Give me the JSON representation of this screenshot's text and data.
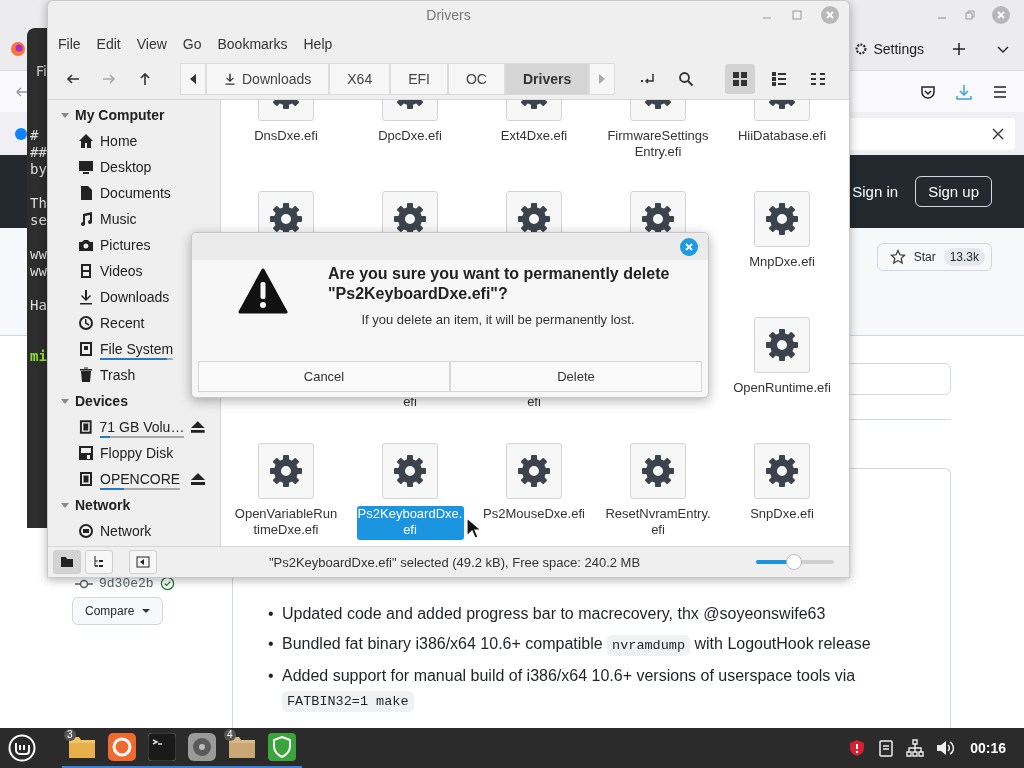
{
  "browser": {
    "tab": {
      "label": "Settings"
    },
    "header": {
      "sign_in": "Sign in",
      "sign_up": "Sign up"
    },
    "star_button": {
      "label": "Star",
      "count": "13.3k"
    },
    "commit": {
      "hash": "9d30e2b"
    },
    "compare_button": "Compare",
    "release_notes": [
      {
        "marker": "•",
        "segments": [
          {
            "kind": "text",
            "text": "Updated code and added progress bar to macrecovery, thx @soyeonswife63"
          }
        ]
      },
      {
        "marker": "•",
        "segments": [
          {
            "kind": "text",
            "text": "Bundled fat binary i386/x64 10.6+ compatible "
          },
          {
            "kind": "code",
            "text": "nvramdump"
          },
          {
            "kind": "text",
            "text": " with LogoutHook release"
          }
        ]
      },
      {
        "marker": "•",
        "segments": [
          {
            "kind": "text",
            "text": "Added support for manual build of i386/x64 10.6+ versions of userspace tools via "
          },
          {
            "kind": "code",
            "text": "FATBIN32=1 make"
          }
        ]
      }
    ]
  },
  "terminal": {
    "title": "Fi",
    "lines": [
      {
        "kind": "plain",
        "text": "#"
      },
      {
        "kind": "plain",
        "text": "##"
      },
      {
        "kind": "plain",
        "text": "by"
      },
      {
        "kind": "blank"
      },
      {
        "kind": "plain",
        "text": "Th"
      },
      {
        "kind": "plain",
        "text": "se"
      },
      {
        "kind": "blank"
      },
      {
        "kind": "plain",
        "text": "ww"
      },
      {
        "kind": "plain",
        "text": "ww"
      },
      {
        "kind": "blank"
      },
      {
        "kind": "plain",
        "text": "Ha"
      },
      {
        "kind": "blank"
      },
      {
        "kind": "blank"
      },
      {
        "kind": "prompt",
        "text": "mi"
      }
    ]
  },
  "file_manager": {
    "title": "Drivers",
    "menu": [
      "File",
      "Edit",
      "View",
      "Go",
      "Bookmarks",
      "Help"
    ],
    "breadcrumbs": [
      {
        "label": "Downloads",
        "kind": "download",
        "selected": false
      },
      {
        "label": "X64",
        "selected": false
      },
      {
        "label": "EFI",
        "selected": false
      },
      {
        "label": "OC",
        "selected": false
      },
      {
        "label": "Drivers",
        "selected": true
      }
    ],
    "views": [
      {
        "kind": "grid",
        "selected": true
      },
      {
        "kind": "list",
        "selected": false
      },
      {
        "kind": "compact",
        "selected": false
      }
    ],
    "sidebar": [
      {
        "title": "My Computer",
        "expanded": true,
        "items": [
          {
            "label": "Home",
            "kind": "home",
            "eject": false
          },
          {
            "label": "Desktop",
            "kind": "desktop",
            "eject": false
          },
          {
            "label": "Documents",
            "kind": "document",
            "eject": false
          },
          {
            "label": "Music",
            "kind": "music",
            "eject": false
          },
          {
            "label": "Pictures",
            "kind": "camera",
            "eject": false
          },
          {
            "label": "Videos",
            "kind": "film",
            "eject": false
          },
          {
            "label": "Downloads",
            "kind": "download",
            "eject": false
          },
          {
            "label": "Recent",
            "kind": "clock",
            "eject": false
          },
          {
            "label": "File System",
            "kind": "drive",
            "level": 0.92,
            "eject": false
          },
          {
            "label": "Trash",
            "kind": "trash",
            "eject": false
          }
        ]
      },
      {
        "title": "Devices",
        "expanded": true,
        "items": [
          {
            "label": "71 GB Volu…",
            "kind": "chip",
            "level": 0.12,
            "eject": true
          },
          {
            "label": "Floppy Disk",
            "kind": "floppy",
            "eject": false
          },
          {
            "label": "OPENCORE",
            "kind": "chip",
            "level": 0.3,
            "eject": true
          }
        ]
      },
      {
        "title": "Network",
        "expanded": true,
        "items": [
          {
            "label": "Network",
            "kind": "globe",
            "eject": false
          }
        ]
      }
    ],
    "files": [
      {
        "kind": "file",
        "lines": [
          "DnsDxe.efi"
        ],
        "selected": false
      },
      {
        "kind": "file",
        "lines": [
          "DpcDxe.efi"
        ],
        "selected": false
      },
      {
        "kind": "file",
        "lines": [
          "Ext4Dxe.efi"
        ],
        "selected": false
      },
      {
        "kind": "file",
        "lines": [
          "FirmwareSettings",
          "Entry.efi"
        ],
        "selected": false
      },
      {
        "kind": "file",
        "lines": [
          "HiiDatabase.efi"
        ],
        "selected": false
      },
      {
        "kind": "file"
      },
      {
        "kind": "file"
      },
      {
        "kind": "file"
      },
      {
        "kind": "file"
      },
      {
        "kind": "file",
        "lines": [
          "MnpDxe.efi"
        ],
        "selected": false
      },
      {
        "kind": "covered"
      },
      {
        "kind": "covered",
        "lines": [
          "efi"
        ],
        "selected": false
      },
      {
        "kind": "covered",
        "lines": [
          "efi"
        ],
        "selected": false
      },
      {
        "kind": "covered"
      },
      {
        "kind": "file",
        "lines": [
          "OpenRuntime.efi"
        ],
        "selected": false
      },
      {
        "kind": "file",
        "lines": [
          "OpenVariableRun",
          "timeDxe.efi"
        ],
        "selected": false
      },
      {
        "kind": "file",
        "lines": [
          "Ps2KeyboardDxe.",
          "efi"
        ],
        "selected": true
      },
      {
        "kind": "file",
        "lines": [
          "Ps2MouseDxe.efi"
        ],
        "selected": false
      },
      {
        "kind": "file",
        "lines": [
          "ResetNvramEntry.",
          "efi"
        ],
        "selected": false
      },
      {
        "kind": "file",
        "lines": [
          "SnpDxe.efi"
        ],
        "selected": false
      }
    ],
    "pane_buttons": [
      {
        "kind": "places",
        "selected": true
      },
      {
        "kind": "tree",
        "selected": false
      },
      {
        "kind": "toggle",
        "selected": false
      }
    ],
    "status": "\"Ps2KeyboardDxe.efi\" selected (49.2 kB), Free space: 240.2 MB",
    "zoom": {
      "level": 0.49
    }
  },
  "dialog": {
    "heading": "Are you sure you want to permanently delete \"Ps2KeyboardDxe.efi\"?",
    "message": "If you delete an item, it will be permanently lost.",
    "buttons": [
      "Cancel",
      "Delete"
    ]
  },
  "taskbar": {
    "apps": [
      {
        "kind": "files",
        "badge": "3",
        "running": true
      },
      {
        "kind": "firefox",
        "running": true
      },
      {
        "kind": "terminal",
        "running": true
      },
      {
        "kind": "disk",
        "running": true
      },
      {
        "kind": "folder",
        "badge": "4",
        "running": true
      },
      {
        "kind": "shield",
        "running": true
      }
    ],
    "clock": "00:16"
  }
}
